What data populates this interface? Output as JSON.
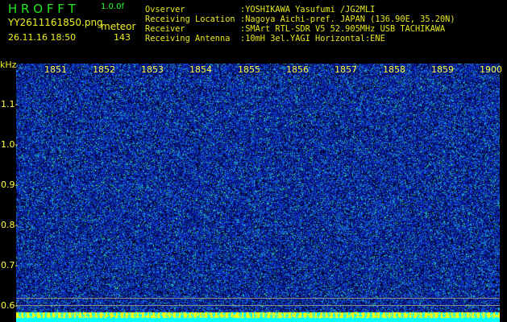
{
  "header": {
    "app_name": "H R O F F T",
    "version": "1.0.0f",
    "filename": "YY2611161850.png",
    "datetime": "26.11.16 18:50",
    "mode": "meteor",
    "count": "143"
  },
  "info": [
    {
      "label": "Ovserver",
      "value": ":YOSHIKAWA Yasufumi /JG2MLI"
    },
    {
      "label": "Receiving Location",
      "value": ":Nagoya Aichi-pref. JAPAN (136.90E, 35.20N)"
    },
    {
      "label": "Receiver",
      "value": ":SMArt RTL-SDR V5 52.905MHz USB TACHIKAWA"
    },
    {
      "label": "Receiving Antenna",
      "value": ":10mH 3el.YAGI Horizontal:ENE"
    }
  ],
  "spectrogram": {
    "y_unit": "kHz",
    "time_ticks": [
      "1851",
      "1852",
      "1853",
      "1854",
      "1855",
      "1856",
      "1857",
      "1858",
      "1859",
      "1900"
    ],
    "freq_ticks": [
      "1.1",
      "1.0",
      "0.9",
      "0.8",
      "0.7",
      "0.6"
    ],
    "colors": {
      "background": "#0a1aa0",
      "noise_high": "#30e0c0",
      "band_yellow": "#ffff00",
      "band_cyan": "#00ffff"
    }
  }
}
